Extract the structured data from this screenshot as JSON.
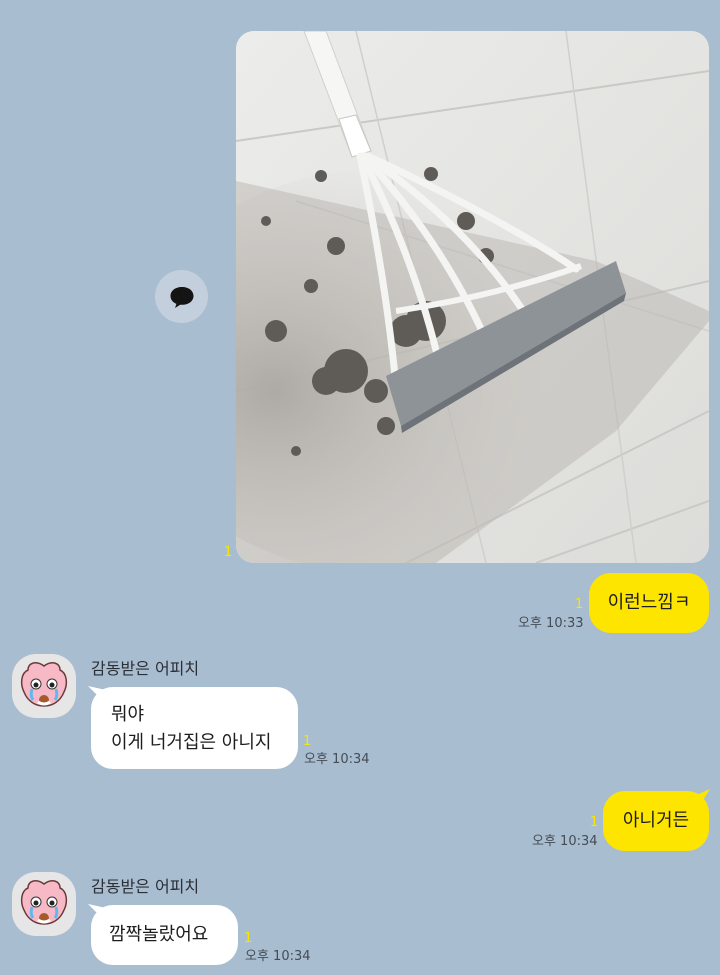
{
  "messages": {
    "m1": {
      "sender": "me",
      "type": "image",
      "unread": "1",
      "alt_icon": "photo-broom-squeegee"
    },
    "m2": {
      "sender": "me",
      "text": "이런느낌ㅋ",
      "unread": "1",
      "time": "오후 10:33"
    },
    "m3": {
      "sender_name": "감동받은 어피치",
      "lines": [
        "뭐야",
        "이게  너거집은 아니지"
      ],
      "unread": "1",
      "time": "오후 10:34"
    },
    "m4": {
      "sender": "me",
      "text": "아니거든",
      "unread": "1",
      "time": "오후 10:34"
    },
    "m5": {
      "sender_name": "감동받은 어피치",
      "text": "깜짝놀랐어요",
      "unread": "1",
      "time": "오후 10:34"
    }
  },
  "icons": {
    "share": "speech-bubble-icon",
    "avatar": "crying-peach-character"
  },
  "colors": {
    "background": "#a9bdd1",
    "my_bubble": "#fee500",
    "their_bubble": "#ffffff",
    "unread": "#f7e600"
  }
}
